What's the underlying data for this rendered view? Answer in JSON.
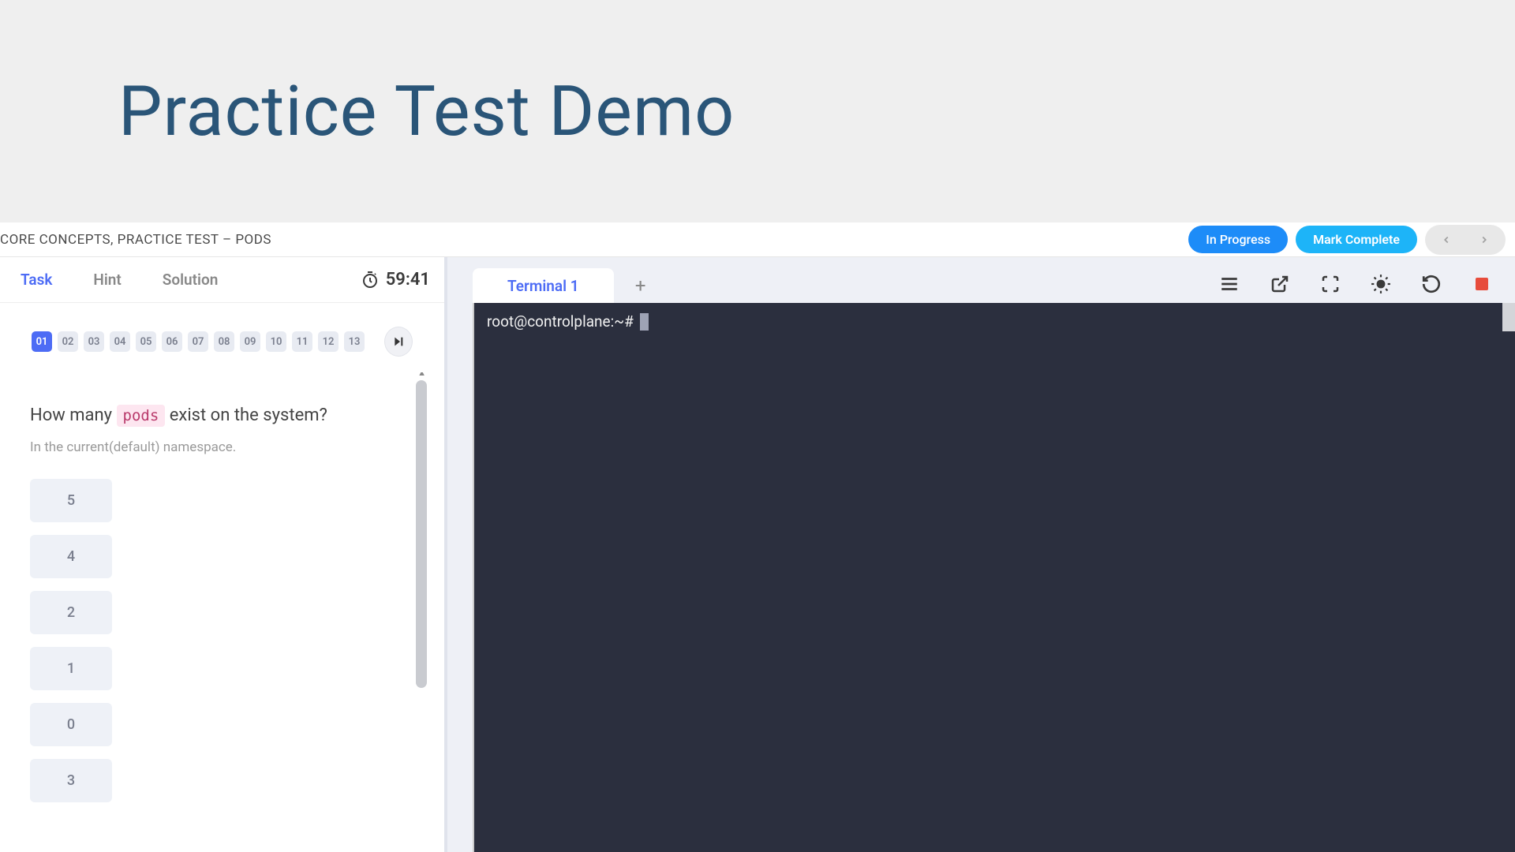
{
  "slide": {
    "title": "Practice Test Demo"
  },
  "breadcrumb": "CORE CONCEPTS, PRACTICE TEST – PODS",
  "status": {
    "in_progress": "In Progress",
    "mark_complete": "Mark Complete"
  },
  "left": {
    "tabs": {
      "task": "Task",
      "hint": "Hint",
      "solution": "Solution"
    },
    "timer": "59:41",
    "steps": [
      "01",
      "02",
      "03",
      "04",
      "05",
      "06",
      "07",
      "08",
      "09",
      "10",
      "11",
      "12",
      "13"
    ],
    "active_step": "01",
    "question": {
      "prefix": "How many ",
      "code": "pods",
      "suffix": " exist on the system?",
      "sub": "In the current(default) namespace."
    },
    "answers": [
      "5",
      "4",
      "2",
      "1",
      "0",
      "3"
    ]
  },
  "terminal": {
    "tab_label": "Terminal 1",
    "add_label": "+",
    "prompt": "root@controlplane:~#"
  }
}
